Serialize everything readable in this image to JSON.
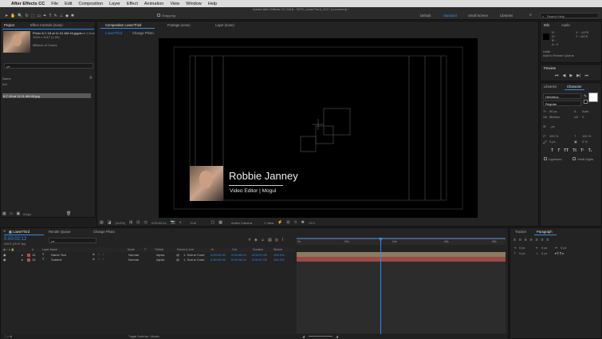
{
  "menu": {
    "app": "After Effects CC",
    "items": [
      "File",
      "Edit",
      "Composition",
      "Layer",
      "Effect",
      "Animation",
      "View",
      "Window",
      "Help"
    ]
  },
  "window_title": "Adobe After Effects CC 2018 - 3379_LowerThird_2017 (converted) *",
  "workspace": {
    "items": [
      "Default",
      "Standard",
      "Small Screen",
      "Libraries"
    ],
    "active": "Standard",
    "search_placeholder": "Search Help",
    "snapping": "Snapping"
  },
  "project": {
    "tabs": [
      "Project",
      "Effect Controls (none)"
    ],
    "asset_name": "Photo 6-7-18 at 11.01 AM #3.jpg ▾",
    "asset_used": ", used 1 time",
    "asset_dims": "1024 x 1017 (1.00)",
    "asset_colors": "Millions of Colors",
    "search_placeholder": "ρ▾",
    "col_name": "Name",
    "folder": "Ind",
    "selected_item": "6-7-18 at 11.01 AM #3.jpg",
    "bpc": "8 bpc"
  },
  "viewer": {
    "tabs": [
      "Composition LowerThird",
      "Footage (none)",
      "Layer (none)"
    ],
    "subtabs": [
      "LowerThird",
      "Change Photo"
    ],
    "name": "Robbie Janney",
    "title": "Video Editor | Mogul",
    "zoom": "(112%)",
    "timecode": "0:00:02:12",
    "resolution": "Full",
    "camera": "Active Camera",
    "views": "1 View",
    "exposure": "+0.0"
  },
  "info": {
    "tabs": [
      "Info",
      "Audio"
    ],
    "r": "R :",
    "g": "G :",
    "b": "B :",
    "a": "A : 0",
    "x": "X : -1079",
    "y": "Y : 1675",
    "units": "Units",
    "hint": "Add to Render Queue"
  },
  "preview": {
    "title": "Preview"
  },
  "character": {
    "tabs": [
      "Libraries",
      "Character"
    ],
    "font": "Helvetica",
    "style": "Regular",
    "size": "50 px",
    "leading": "Auto",
    "kerning": "Metrics",
    "tracking": "0",
    "stroke": "- px",
    "vscale": "100 %",
    "hscale": "100 %",
    "baseline": "0 px",
    "tsume": "0 %",
    "ligatures": "Ligatures",
    "hindi": "Hindi Digits"
  },
  "paragraph": {
    "tabs": [
      "Tracker",
      "Paragraph"
    ],
    "indent1": "0 px",
    "indent2": "0 px",
    "indent3": "0 px",
    "space1": "0 px",
    "space2": "0 px"
  },
  "timeline": {
    "tabs": [
      "LowerThird",
      "Render Queue",
      "Change Photo"
    ],
    "timecode": "0:00:02:12",
    "frames": "00072 (29.97 fps)",
    "search_placeholder": "ρ▾",
    "columns": [
      "#",
      "Layer Name",
      "Mode",
      "T",
      "TrkMat",
      "Parent & Link",
      "In",
      "Out",
      "Duration",
      "Stretch"
    ],
    "layers": [
      {
        "num": "14",
        "name": "Name Text",
        "mode": "Normal",
        "trkmat": "Alpha",
        "parent": "1. Scene Contr",
        "in": "0:00:00:00",
        "out": "0:00:06:24",
        "dur": "0:00:07:00",
        "stretch": "100.0%"
      },
      {
        "num": "15",
        "name": "Subtext",
        "mode": "Normal",
        "trkmat": "Alpha",
        "parent": "1. Scene Contr",
        "in": "0:00:00:00",
        "out": "0:00:06:24",
        "dur": "0:00:07:00",
        "stretch": "100.0%"
      }
    ],
    "ruler": [
      "0s",
      "02s",
      "04s",
      "06s",
      "08s"
    ],
    "toggle": "Toggle Switches / Modes"
  }
}
